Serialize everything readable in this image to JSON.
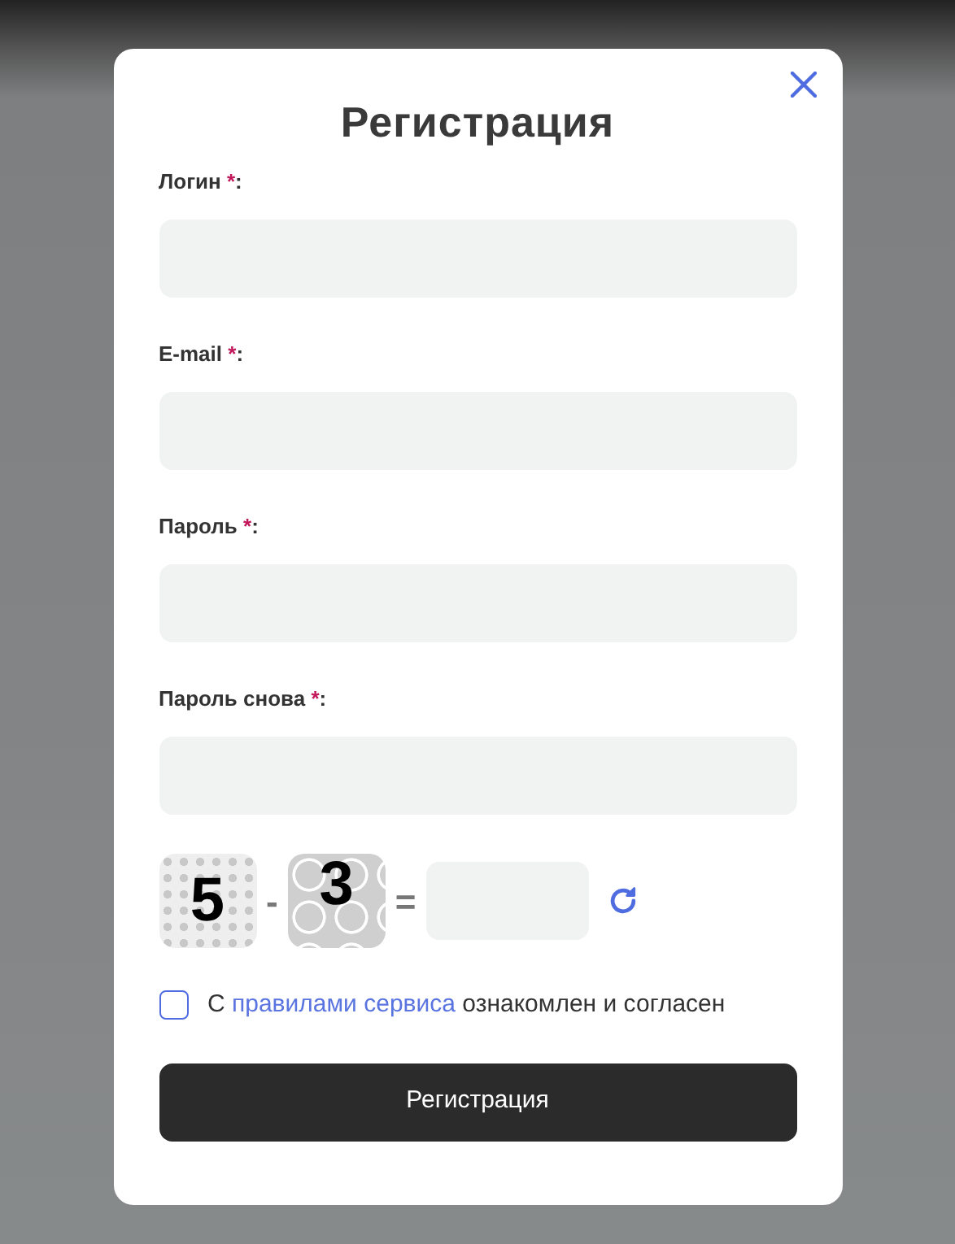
{
  "dialog": {
    "title": "Регистрация"
  },
  "fields": [
    {
      "label": "Логин",
      "required_mark": "*",
      "suffix": ":"
    },
    {
      "label": "E-mail",
      "required_mark": "*",
      "suffix": ":"
    },
    {
      "label": "Пароль",
      "required_mark": "*",
      "suffix": ":"
    },
    {
      "label": "Пароль снова",
      "required_mark": "*",
      "suffix": ":"
    }
  ],
  "captcha": {
    "first": "5",
    "operator": "-",
    "second": "3",
    "equals": "="
  },
  "agreement": {
    "checked": false,
    "before": "С",
    "link": "правилами сервиса",
    "after": "ознакомлен и согласен"
  },
  "submit": "Регистрация"
}
